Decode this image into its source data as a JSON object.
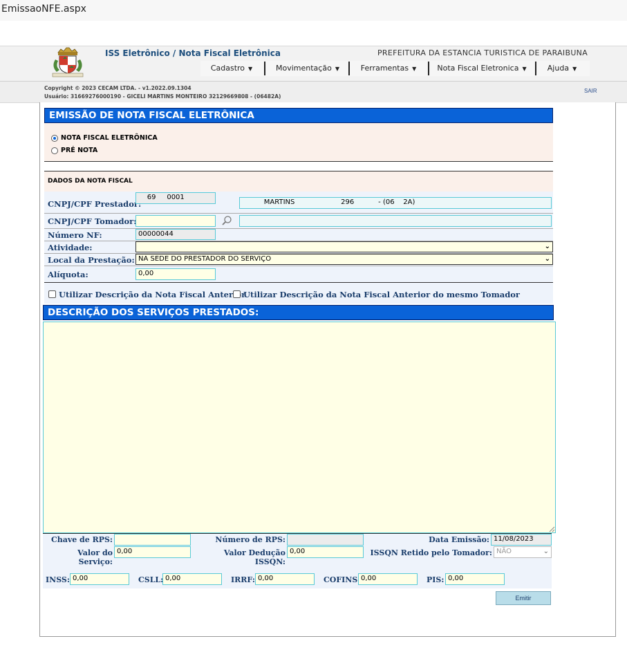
{
  "browser": {
    "tab_title": "EmissaoNFE.aspx"
  },
  "header": {
    "app_title": "ISS Eletrônico / Nota Fiscal Eletrônica",
    "prefeitura": "PREFEITURA DA ESTANCIA TURISTICA DE PARAIBUNA",
    "menu": [
      "Cadastro",
      "Movimentação",
      "Ferramentas",
      "Nota Fiscal Eletronica",
      "Ajuda"
    ],
    "copyright": "Copyright © 2023 CECAM LTDA. - v1.2022.09.1304",
    "usuario": "Usuário: 31669276000190 - GICELI MARTINS MONTEIRO 32129669808 - (06482A)",
    "logout": "SAIR"
  },
  "form": {
    "title": "EMISSÃO DE NOTA FISCAL ELETRÔNICA",
    "radio_nfe": "NOTA FISCAL ELETRÔNICA",
    "radio_pre": "PRÉ NOTA",
    "dados_title": "DADOS DA NOTA FISCAL",
    "prestador_label": "CNPJ/CPF Prestador:",
    "prestador_value": "    69     0001",
    "prestador_nome": "          MARTINS                     296           - (06    2A)",
    "tomador_label": "CNPJ/CPF Tomador:",
    "tomador_value": "",
    "tomador_nome": "",
    "numero_label": "Número NF:",
    "numero_value": "00000044",
    "atividade_label": "Atividade:",
    "atividade_value": "",
    "local_label": "Local da Prestação:",
    "local_value": "NA SEDE DO PRESTADOR DO SERVIÇO",
    "aliquota_label": "Alíquota:",
    "aliquota_value": "0,00",
    "chk1": "Utilizar Descrição da Nota Fiscal Anterior",
    "chk2": "Utilizar Descrição da Nota Fiscal Anterior do mesmo Tomador",
    "desc_title": "DESCRIÇÃO DOS SERVIÇOS PRESTADOS:",
    "desc_value": "",
    "chave_rps_label": "Chave de RPS:",
    "chave_rps_value": "",
    "numero_rps_label": "Número de RPS:",
    "numero_rps_value": "",
    "data_emissao_label": "Data Emissão:",
    "data_emissao_value": "11/08/2023",
    "valor_servico_label": "Valor do Serviço:",
    "valor_servico_value": "0,00",
    "valor_deducao_label": "Valor Dedução ISSQN:",
    "valor_deducao_value": "0,00",
    "issqn_retido_label": "ISSQN Retido pelo Tomador:",
    "issqn_retido_value": "NÃO",
    "inss_label": "INSS:",
    "inss_value": "0,00",
    "csll_label": "CSLL:",
    "csll_value": "0,00",
    "irrf_label": "IRRF:",
    "irrf_value": "0,00",
    "cofins_label": "COFINS:",
    "cofins_value": "0,00",
    "pis_label": "PIS:",
    "pis_value": "0,00",
    "emitir": "Emitir"
  }
}
